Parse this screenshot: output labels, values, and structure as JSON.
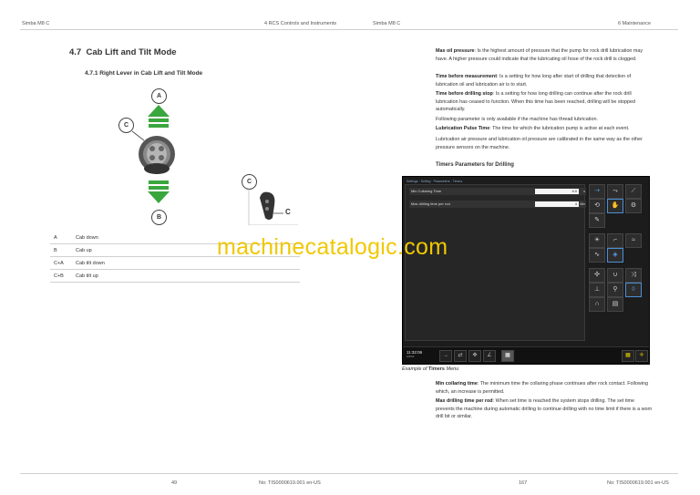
{
  "header": {
    "left_doc": "Simba M8 C",
    "left_chapter": "4 RCS Controls and Instruments",
    "right_doc": "Simba M8 C",
    "right_chapter": "6 Maintenance"
  },
  "left": {
    "section_number": "4.7",
    "section_title": "Cab Lift and Tilt Mode",
    "subsection": "4.7.1 Right Lever in Cab Lift and Tilt Mode",
    "callout_a": "A",
    "callout_b": "B",
    "callout_c": "C",
    "callout_c2": "C",
    "callout_c3": "C",
    "table": [
      {
        "key": "A",
        "value": "Cab down"
      },
      {
        "key": "B",
        "value": "Cab up"
      },
      {
        "key": "C+A",
        "value": "Cab tilt down"
      },
      {
        "key": "C+B",
        "value": "Cab tilt up"
      }
    ]
  },
  "right": {
    "p1_term": "Max oil pressure",
    "p1_text": ": Is the highest amount of pressure that the pump for rock drill lubrication may have. A higher pressure could indicate that the lubricating oil hose of the rock drill is clogged.",
    "p2_term": "Time before measurement",
    "p2_text": ": Is a setting for how long after start of drilling that detection of lubrication oil and lubrication air is to start.",
    "p3_term": "Time before drilling stop",
    "p3_text": ": Is a setting for how long drilling can continue after the rock drill lubrication has ceased to function. When this time has been reached, drilling will be stopped automatically.",
    "p4_text": "Following parameter is only available if the machine has thread lubrication.",
    "p5_term": "Lubrication Pulse Time",
    "p5_text": ": The time for which the lubrication pump is active at each event.",
    "p6_text": "Lubrication air pressure and lubrication oil pressure are calibrated in the same way as the other pressure sensors on the machine.",
    "timers_title": "Timers Parameters for Drilling",
    "screen": {
      "tabs": "Settings · Drilling · Parameters · Timers",
      "row1_label": "Min Collaring Time",
      "row1_value": "4.0",
      "row1_unit": "s",
      "row2_label": "Max drilling time per rod",
      "row2_value": "4",
      "row2_unit": "Min",
      "clock_time": "11:32:06",
      "clock_date": "2/2/19"
    },
    "caption_prefix": "Example of ",
    "caption_bold": "Timers",
    "caption_suffix": " Menu",
    "p7_term": "Min collaring time",
    "p7_text": ": The minimum time the collaring phase continues after rock contact. Following which, an increase is permitted.",
    "p8_term": "Max drilling time per rod",
    "p8_text": ": When set time is reached the system stops drilling. The set time prevents the machine during automatic drilling to continue drilling with no time limit if there is a worn drill bit or similar."
  },
  "watermark": "machinecatalogic.com",
  "footer": {
    "left_page": "49",
    "left_doc_no": "No: TIS0000619.001 en-US",
    "right_page": "167",
    "right_doc_no": "No: TIS0000619.001 en-US"
  },
  "colors": {
    "arrow_green": "#3aa63e",
    "watermark": "#f0c800",
    "screen_bg": "#1c1c1c",
    "highlight_blue": "#4c8fd6"
  },
  "icons": [
    "lever-icon",
    "hand-lever-icon",
    "up-arrow-icon",
    "down-arrow-icon"
  ]
}
